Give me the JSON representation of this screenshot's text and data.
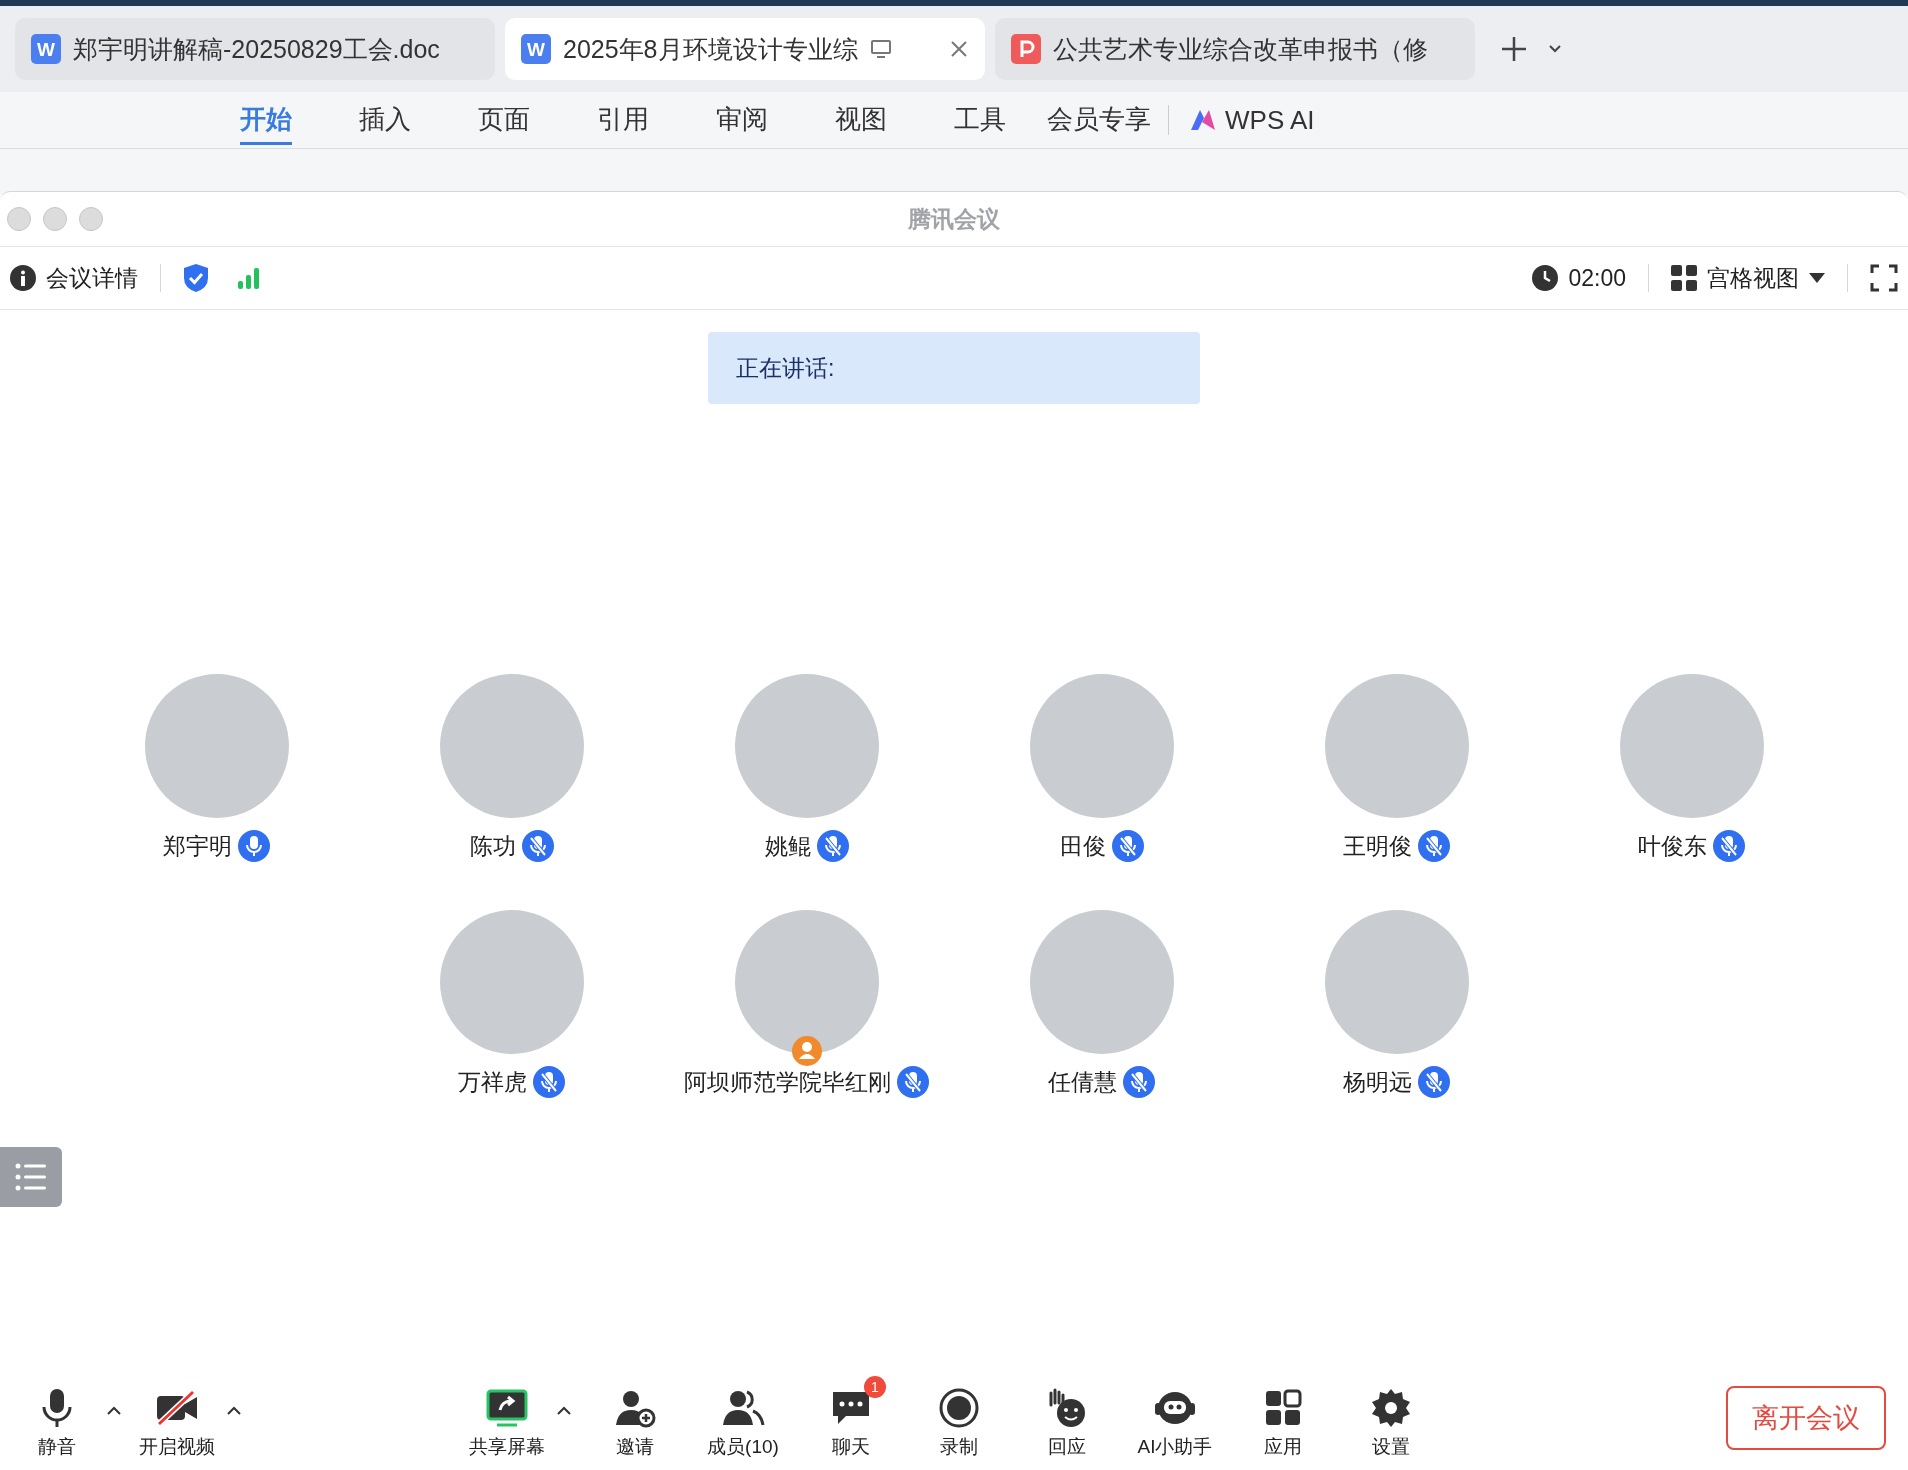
{
  "doc_tabs": [
    {
      "label": "郑宇明讲解稿-20250829工会.doc",
      "kind": "word",
      "icon_text": "W",
      "selected": false
    },
    {
      "label": "2025年8月环境设计专业综",
      "kind": "word",
      "icon_text": "W",
      "selected": true
    },
    {
      "label": "公共艺术专业综合改革申报书（修",
      "kind": "pdf",
      "selected": false
    }
  ],
  "ribbon": [
    {
      "label": "开始",
      "selected": true
    },
    {
      "label": "插入",
      "selected": false
    },
    {
      "label": "页面",
      "selected": false
    },
    {
      "label": "引用",
      "selected": false
    },
    {
      "label": "审阅",
      "selected": false
    },
    {
      "label": "视图",
      "selected": false
    },
    {
      "label": "工具",
      "selected": false
    },
    {
      "label": "会员专享",
      "selected": false
    }
  ],
  "ribbon_ai": "WPS AI",
  "meeting": {
    "title": "腾讯会议",
    "details": "会议详情",
    "timer": "02:00",
    "view": "宫格视图",
    "speaking_label": "正在讲话:"
  },
  "participant_rows": [
    [
      {
        "name": "郑宇明",
        "muted": false,
        "guest_badge": false
      },
      {
        "name": "陈功",
        "muted": true,
        "guest_badge": false
      },
      {
        "name": "姚鲲",
        "muted": true,
        "guest_badge": false
      },
      {
        "name": "田俊",
        "muted": true,
        "guest_badge": false
      },
      {
        "name": "王明俊",
        "muted": true,
        "guest_badge": false
      },
      {
        "name": "叶俊东",
        "muted": true,
        "guest_badge": false
      }
    ],
    [
      {
        "name": "万祥虎",
        "muted": true,
        "guest_badge": false
      },
      {
        "name": "阿坝师范学院毕红刚",
        "muted": true,
        "guest_badge": true
      },
      {
        "name": "任倩慧",
        "muted": true,
        "guest_badge": false
      },
      {
        "name": "杨明远",
        "muted": true,
        "guest_badge": false
      }
    ]
  ],
  "toolbar": {
    "left": [
      {
        "kind": "mic",
        "label": "静音",
        "on": true,
        "menu": true
      },
      {
        "kind": "video",
        "label": "开启视频",
        "on": false,
        "menu": true
      }
    ],
    "center": [
      {
        "kind": "share",
        "label": "共享屏幕",
        "menu": true
      },
      {
        "kind": "invite",
        "label": "邀请",
        "menu": false
      },
      {
        "kind": "members",
        "label": "成员(10)",
        "menu": false
      },
      {
        "kind": "chat",
        "label": "聊天",
        "menu": false,
        "badge": "1"
      },
      {
        "kind": "record",
        "label": "录制",
        "menu": false
      },
      {
        "kind": "react",
        "label": "回应",
        "menu": false
      },
      {
        "kind": "ai",
        "label": "AI小助手",
        "menu": false
      },
      {
        "kind": "apps",
        "label": "应用",
        "menu": false
      },
      {
        "kind": "settings",
        "label": "设置",
        "menu": false
      }
    ],
    "leave": "离开会议"
  }
}
